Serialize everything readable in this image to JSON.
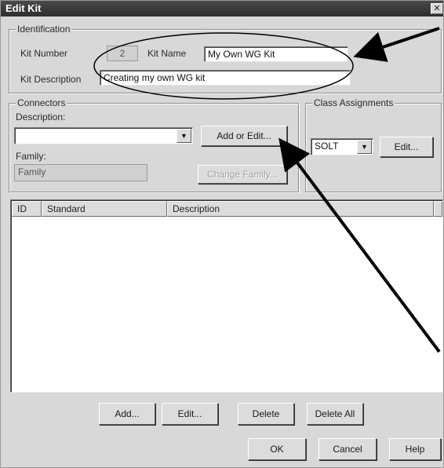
{
  "window": {
    "title": "Edit Kit",
    "close_glyph": "✕"
  },
  "identification": {
    "legend": "Identification",
    "kit_number_label": "Kit Number",
    "kit_number_value": "2",
    "kit_name_label": "Kit Name",
    "kit_name_value": "My Own WG Kit",
    "kit_description_label": "Kit Description",
    "kit_description_value": "Creating my own WG kit"
  },
  "connectors": {
    "legend": "Connectors",
    "description_label": "Description:",
    "description_value": "",
    "dropdown_glyph": "▼",
    "add_edit_button": "Add or Edit...",
    "family_label": "Family:",
    "family_value": "Family",
    "change_family_button": "Change Family..."
  },
  "class_assignments": {
    "legend": "Class Assignments",
    "selected": "SOLT",
    "dropdown_glyph": "▼",
    "edit_button": "Edit..."
  },
  "standards_list": {
    "columns": [
      "ID",
      "Standard",
      "Description"
    ]
  },
  "list_buttons": {
    "add": "Add...",
    "edit": "Edit...",
    "delete": "Delete",
    "delete_all": "Delete All"
  },
  "dialog_buttons": {
    "ok": "OK",
    "cancel": "Cancel",
    "help": "Help"
  },
  "colors": {
    "dialog_bg": "#d8d8d8",
    "title_bar": "#3a3a3a",
    "annotation": "#000000"
  }
}
